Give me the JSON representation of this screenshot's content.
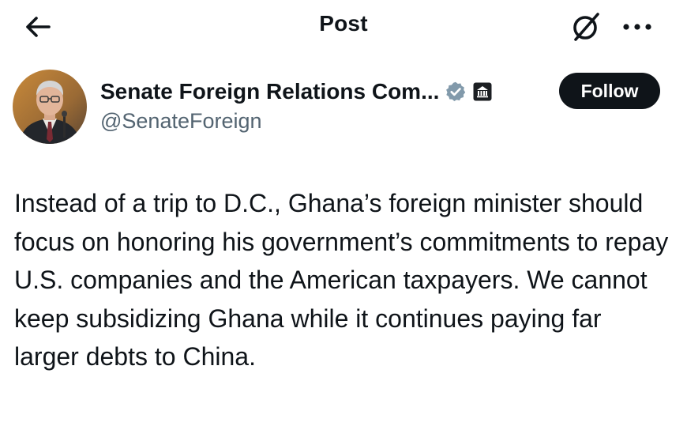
{
  "header": {
    "title": "Post",
    "back_icon": "arrow-left-icon",
    "grok_icon": "grok-icon",
    "more_icon": "more-horizontal-icon"
  },
  "author": {
    "display_name": "Senate Foreign Relations Com...",
    "handle": "@SenateForeign",
    "verified_badge": "verified-gray-badge-icon",
    "affiliation_badge": "government-building-icon",
    "follow_label": "Follow"
  },
  "post": {
    "text": "Instead of a trip to D.C., Ghana’s foreign minister should focus on honoring his government’s commitments to repay U.S. companies and the American taxpayers. We cannot keep subsidizing Ghana while it continues paying far larger debts to China."
  },
  "colors": {
    "text_primary": "#0f1419",
    "text_secondary": "#536471",
    "follow_bg": "#0f1419",
    "verified_gray": "#829aab"
  }
}
